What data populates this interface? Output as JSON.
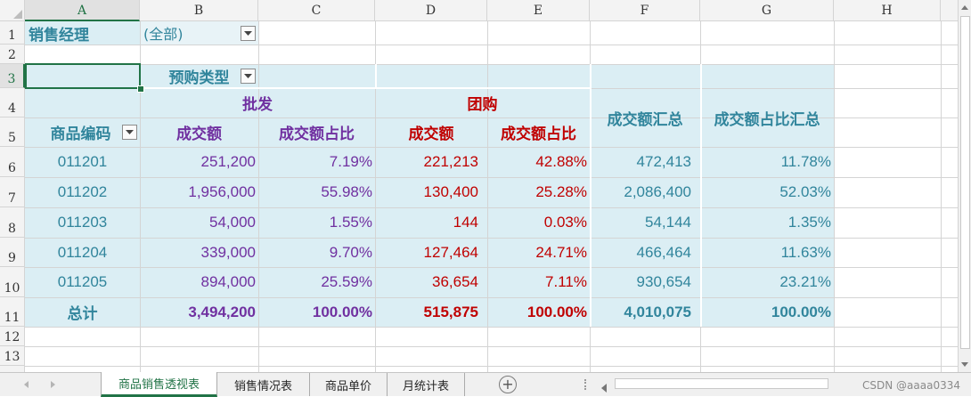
{
  "columns": [
    "A",
    "B",
    "C",
    "D",
    "E",
    "F",
    "G",
    "H"
  ],
  "rows": [
    "1",
    "2",
    "3",
    "4",
    "5",
    "6",
    "7",
    "8",
    "9",
    "10",
    "11",
    "12",
    "13"
  ],
  "filter": {
    "label": "销售经理",
    "value": "(全部)"
  },
  "pivot": {
    "column_field": "预购类型",
    "row_field": "商品编码",
    "group1": "批发",
    "group2": "团购",
    "sub_amount": "成交额",
    "sub_ratio": "成交额占比",
    "total_amount_header": "成交额汇总",
    "total_ratio_header": "成交额占比汇总",
    "total_label": "总计",
    "rows": [
      [
        "011201",
        "251,200",
        "7.19%",
        "221,213",
        "42.88%",
        "472,413",
        "11.78%"
      ],
      [
        "011202",
        "1,956,000",
        "55.98%",
        "130,400",
        "25.28%",
        "2,086,400",
        "52.03%"
      ],
      [
        "011203",
        "54,000",
        "1.55%",
        "144",
        "0.03%",
        "54,144",
        "1.35%"
      ],
      [
        "011204",
        "339,000",
        "9.70%",
        "127,464",
        "24.71%",
        "466,464",
        "11.63%"
      ],
      [
        "011205",
        "894,000",
        "25.59%",
        "36,654",
        "7.11%",
        "930,654",
        "23.21%"
      ]
    ],
    "totals": [
      "3,494,200",
      "100.00%",
      "515,875",
      "100.00%",
      "4,010,075",
      "100.00%"
    ]
  },
  "tabs": [
    "商品销售透视表",
    "销售情况表",
    "商品单价",
    "月统计表"
  ],
  "active_tab": "商品销售透视表",
  "add_sheet_label": "+",
  "watermark": "CSDN @aaaa0334",
  "colors": {
    "teal": "#31859c",
    "purple": "#7030a0",
    "red": "#c00000",
    "excel_green": "#217346",
    "pivot_fill": "#dbeef4"
  }
}
